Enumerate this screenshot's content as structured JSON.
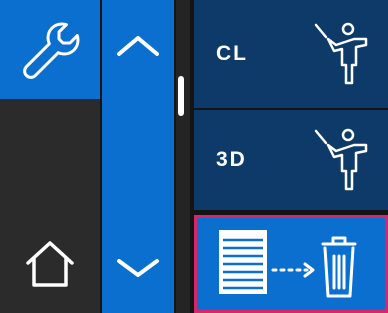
{
  "tools": {
    "settings_icon": "wrench-icon",
    "home_icon": "home-icon"
  },
  "scroll": {
    "up_icon": "chevron-up-icon",
    "down_icon": "chevron-down-icon"
  },
  "list": {
    "items": [
      {
        "label": "CL",
        "icon": "calibration-figure-icon"
      },
      {
        "label": "3D",
        "icon": "calibration-figure-icon"
      },
      {
        "label": "",
        "icon": "list-to-trash-icon"
      }
    ]
  },
  "colors": {
    "primary_blue": "#0a6fcf",
    "dark_blue": "#0e3a6a",
    "selection_border": "#d6276c"
  }
}
